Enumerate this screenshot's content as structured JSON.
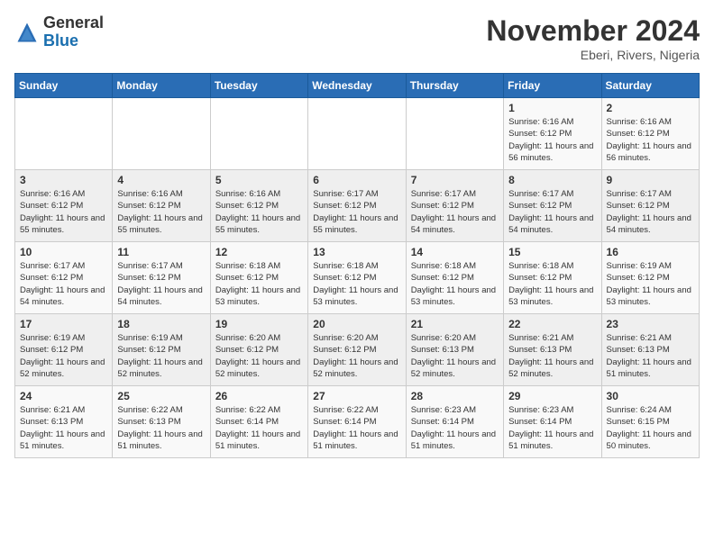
{
  "logo": {
    "general": "General",
    "blue": "Blue"
  },
  "header": {
    "month_title": "November 2024",
    "location": "Eberi, Rivers, Nigeria"
  },
  "weekdays": [
    "Sunday",
    "Monday",
    "Tuesday",
    "Wednesday",
    "Thursday",
    "Friday",
    "Saturday"
  ],
  "weeks": [
    [
      {
        "day": "",
        "content": ""
      },
      {
        "day": "",
        "content": ""
      },
      {
        "day": "",
        "content": ""
      },
      {
        "day": "",
        "content": ""
      },
      {
        "day": "",
        "content": ""
      },
      {
        "day": "1",
        "content": "Sunrise: 6:16 AM\nSunset: 6:12 PM\nDaylight: 11 hours and 56 minutes."
      },
      {
        "day": "2",
        "content": "Sunrise: 6:16 AM\nSunset: 6:12 PM\nDaylight: 11 hours and 56 minutes."
      }
    ],
    [
      {
        "day": "3",
        "content": "Sunrise: 6:16 AM\nSunset: 6:12 PM\nDaylight: 11 hours and 55 minutes."
      },
      {
        "day": "4",
        "content": "Sunrise: 6:16 AM\nSunset: 6:12 PM\nDaylight: 11 hours and 55 minutes."
      },
      {
        "day": "5",
        "content": "Sunrise: 6:16 AM\nSunset: 6:12 PM\nDaylight: 11 hours and 55 minutes."
      },
      {
        "day": "6",
        "content": "Sunrise: 6:17 AM\nSunset: 6:12 PM\nDaylight: 11 hours and 55 minutes."
      },
      {
        "day": "7",
        "content": "Sunrise: 6:17 AM\nSunset: 6:12 PM\nDaylight: 11 hours and 54 minutes."
      },
      {
        "day": "8",
        "content": "Sunrise: 6:17 AM\nSunset: 6:12 PM\nDaylight: 11 hours and 54 minutes."
      },
      {
        "day": "9",
        "content": "Sunrise: 6:17 AM\nSunset: 6:12 PM\nDaylight: 11 hours and 54 minutes."
      }
    ],
    [
      {
        "day": "10",
        "content": "Sunrise: 6:17 AM\nSunset: 6:12 PM\nDaylight: 11 hours and 54 minutes."
      },
      {
        "day": "11",
        "content": "Sunrise: 6:17 AM\nSunset: 6:12 PM\nDaylight: 11 hours and 54 minutes."
      },
      {
        "day": "12",
        "content": "Sunrise: 6:18 AM\nSunset: 6:12 PM\nDaylight: 11 hours and 53 minutes."
      },
      {
        "day": "13",
        "content": "Sunrise: 6:18 AM\nSunset: 6:12 PM\nDaylight: 11 hours and 53 minutes."
      },
      {
        "day": "14",
        "content": "Sunrise: 6:18 AM\nSunset: 6:12 PM\nDaylight: 11 hours and 53 minutes."
      },
      {
        "day": "15",
        "content": "Sunrise: 6:18 AM\nSunset: 6:12 PM\nDaylight: 11 hours and 53 minutes."
      },
      {
        "day": "16",
        "content": "Sunrise: 6:19 AM\nSunset: 6:12 PM\nDaylight: 11 hours and 53 minutes."
      }
    ],
    [
      {
        "day": "17",
        "content": "Sunrise: 6:19 AM\nSunset: 6:12 PM\nDaylight: 11 hours and 52 minutes."
      },
      {
        "day": "18",
        "content": "Sunrise: 6:19 AM\nSunset: 6:12 PM\nDaylight: 11 hours and 52 minutes."
      },
      {
        "day": "19",
        "content": "Sunrise: 6:20 AM\nSunset: 6:12 PM\nDaylight: 11 hours and 52 minutes."
      },
      {
        "day": "20",
        "content": "Sunrise: 6:20 AM\nSunset: 6:12 PM\nDaylight: 11 hours and 52 minutes."
      },
      {
        "day": "21",
        "content": "Sunrise: 6:20 AM\nSunset: 6:13 PM\nDaylight: 11 hours and 52 minutes."
      },
      {
        "day": "22",
        "content": "Sunrise: 6:21 AM\nSunset: 6:13 PM\nDaylight: 11 hours and 52 minutes."
      },
      {
        "day": "23",
        "content": "Sunrise: 6:21 AM\nSunset: 6:13 PM\nDaylight: 11 hours and 51 minutes."
      }
    ],
    [
      {
        "day": "24",
        "content": "Sunrise: 6:21 AM\nSunset: 6:13 PM\nDaylight: 11 hours and 51 minutes."
      },
      {
        "day": "25",
        "content": "Sunrise: 6:22 AM\nSunset: 6:13 PM\nDaylight: 11 hours and 51 minutes."
      },
      {
        "day": "26",
        "content": "Sunrise: 6:22 AM\nSunset: 6:14 PM\nDaylight: 11 hours and 51 minutes."
      },
      {
        "day": "27",
        "content": "Sunrise: 6:22 AM\nSunset: 6:14 PM\nDaylight: 11 hours and 51 minutes."
      },
      {
        "day": "28",
        "content": "Sunrise: 6:23 AM\nSunset: 6:14 PM\nDaylight: 11 hours and 51 minutes."
      },
      {
        "day": "29",
        "content": "Sunrise: 6:23 AM\nSunset: 6:14 PM\nDaylight: 11 hours and 51 minutes."
      },
      {
        "day": "30",
        "content": "Sunrise: 6:24 AM\nSunset: 6:15 PM\nDaylight: 11 hours and 50 minutes."
      }
    ]
  ]
}
